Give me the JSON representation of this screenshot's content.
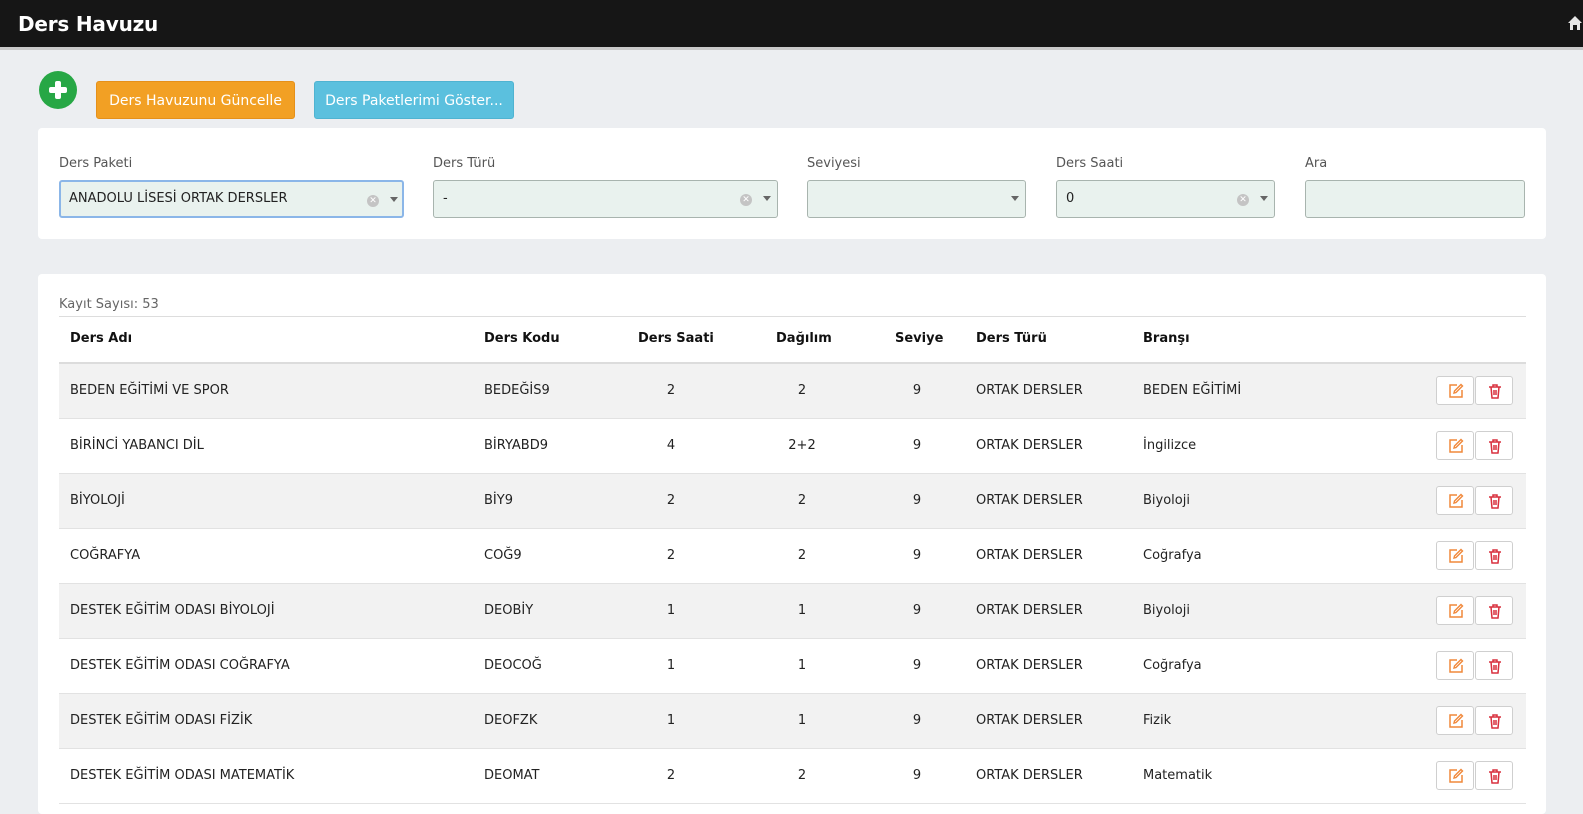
{
  "header": {
    "title": "Ders Havuzu"
  },
  "toolbar": {
    "update_label": "Ders Havuzunu Güncelle",
    "packages_label": "Ders Paketlerimi Göster..."
  },
  "filters": {
    "package": {
      "label": "Ders Paketi",
      "value": "ANADOLU LİSESİ ORTAK DERSLER"
    },
    "type": {
      "label": "Ders Türü",
      "value": "-"
    },
    "level": {
      "label": "Seviyesi",
      "value": ""
    },
    "hours": {
      "label": "Ders Saati",
      "value": "0"
    },
    "search": {
      "label": "Ara",
      "value": ""
    }
  },
  "table": {
    "count": "Kayıt Sayısı: 53",
    "headers": [
      "Ders Adı",
      "Ders Kodu",
      "Ders Saati",
      "Dağılım",
      "Seviye",
      "Ders Türü",
      "Branşı"
    ],
    "rows": [
      [
        "BEDEN EĞİTİMİ VE SPOR",
        "BEDEĞİS9",
        "2",
        "2",
        "9",
        "ORTAK DERSLER",
        "BEDEN EĞİTİMİ"
      ],
      [
        "BİRİNCİ YABANCI DİL",
        "BİRYABD9",
        "4",
        "2+2",
        "9",
        "ORTAK DERSLER",
        "İngilizce"
      ],
      [
        "BİYOLOJİ",
        "BİY9",
        "2",
        "2",
        "9",
        "ORTAK DERSLER",
        "Biyoloji"
      ],
      [
        "COĞRAFYA",
        "COĞ9",
        "2",
        "2",
        "9",
        "ORTAK DERSLER",
        "Coğrafya"
      ],
      [
        "DESTEK EĞİTİM ODASI BİYOLOJİ",
        "DEOBİY",
        "1",
        "1",
        "9",
        "ORTAK DERSLER",
        "Biyoloji"
      ],
      [
        "DESTEK EĞİTİM ODASI COĞRAFYA",
        "DEOCOĞ",
        "1",
        "1",
        "9",
        "ORTAK DERSLER",
        "Coğrafya"
      ],
      [
        "DESTEK EĞİTİM ODASI FİZİK",
        "DEOFZK",
        "1",
        "1",
        "9",
        "ORTAK DERSLER",
        "Fizik"
      ],
      [
        "DESTEK EĞİTİM ODASI MATEMATİK",
        "DEOMAT",
        "2",
        "2",
        "9",
        "ORTAK DERSLER",
        "Matematik"
      ]
    ]
  },
  "icons": {
    "add": "plus-circle-icon",
    "edit": "edit-icon",
    "delete": "trash-icon",
    "home": "home-icon"
  },
  "colors": {
    "edit": "#f0883a",
    "delete": "#d9303e",
    "add": "#27a745"
  }
}
